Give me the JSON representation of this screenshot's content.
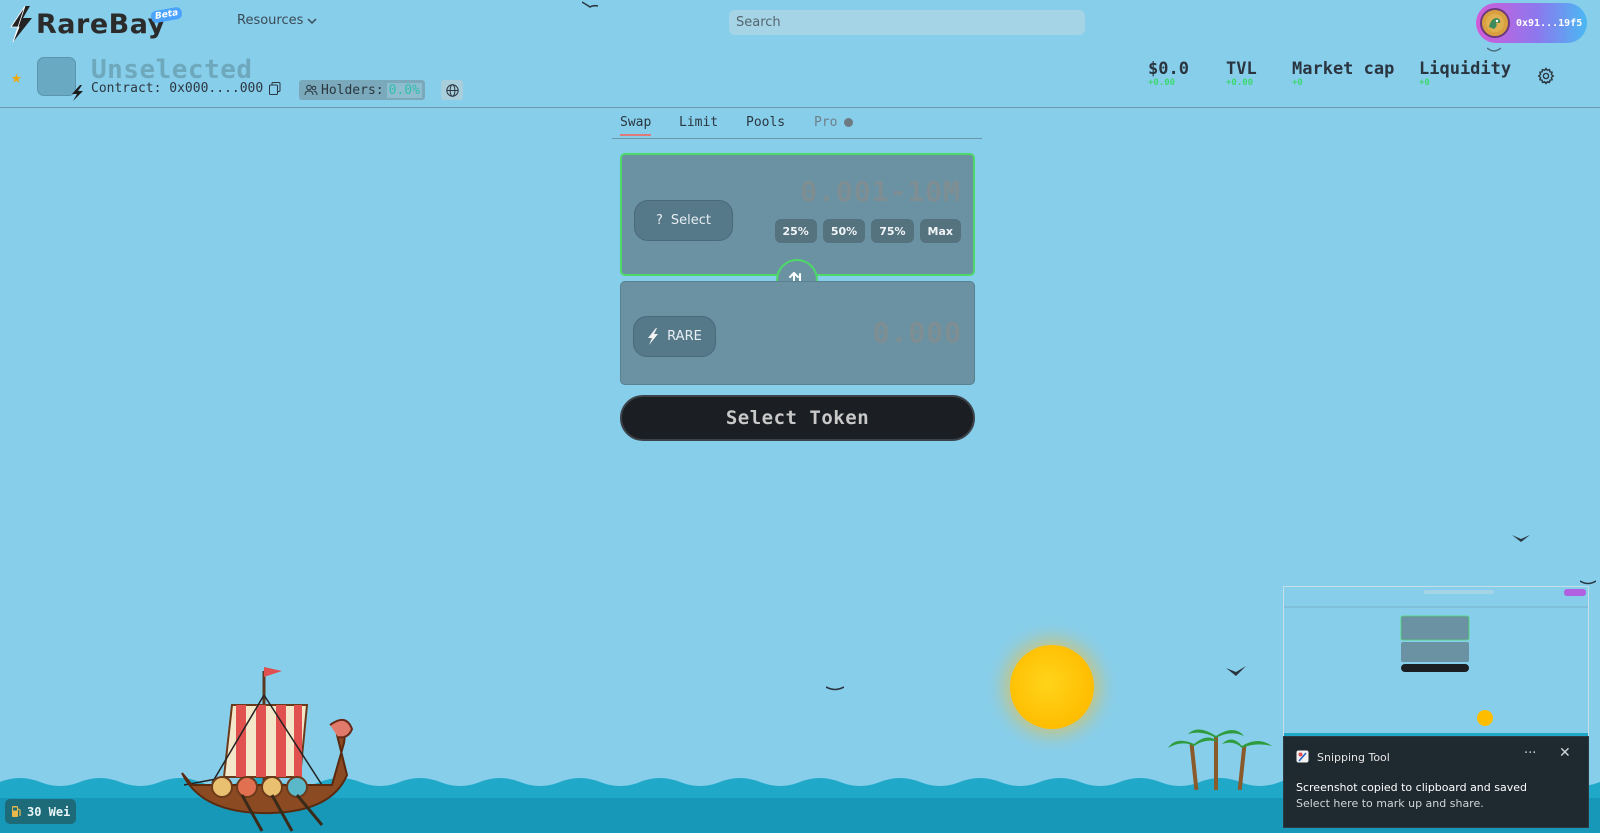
{
  "header": {
    "logo_text": "RareBay",
    "beta_badge": "Beta",
    "resources_label": "Resources",
    "search_placeholder": "Search",
    "wallet_address": "0x91...19f5"
  },
  "token": {
    "name": "Unselected",
    "contract_label": "Contract: 0x000....000",
    "holders_label": "Holders:",
    "holders_pct": "0.0%"
  },
  "stats": [
    {
      "label": "$0.0",
      "change": "+0.00"
    },
    {
      "label": "TVL",
      "change": "+0.00"
    },
    {
      "label": "Market cap",
      "change": "+0"
    },
    {
      "label": "Liquidity",
      "change": "+0"
    }
  ],
  "tabs": [
    {
      "label": "Swap",
      "active": true
    },
    {
      "label": "Limit",
      "active": false
    },
    {
      "label": "Pools",
      "active": false
    },
    {
      "label": "Pro",
      "active": false
    }
  ],
  "swap": {
    "from_select_label": "Select",
    "from_select_icon": "?",
    "from_amount_placeholder": "0.001-10M",
    "pct_buttons": [
      "25%",
      "50%",
      "75%",
      "Max"
    ],
    "to_token_label": "RARE",
    "to_amount": "0.000",
    "cta_label": "Select Token"
  },
  "gas": {
    "label": "30 Wei"
  },
  "snipping_tool": {
    "app_name": "Snipping Tool",
    "message": "Screenshot copied to clipboard and saved",
    "submessage": "Select here to mark up and share.",
    "more": "···",
    "close": "✕"
  },
  "colors": {
    "sky": "#87CEEB",
    "accent_green": "#4ed86a",
    "card": "#6b92a2",
    "cta_bg": "#1b1f23",
    "star": "#f0a80b",
    "sun": "#ffbd00"
  }
}
